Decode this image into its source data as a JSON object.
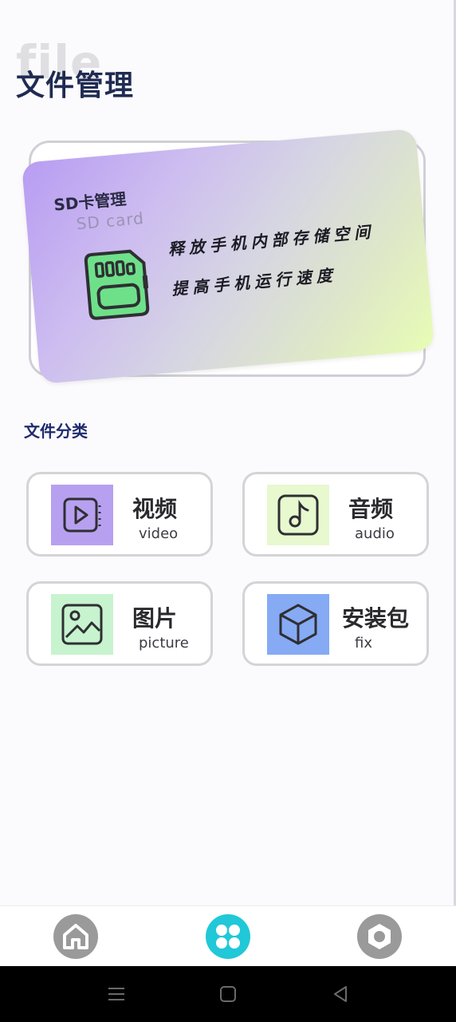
{
  "header": {
    "watermark": "file",
    "title": "文件管理"
  },
  "banner": {
    "title": "SD卡管理",
    "subtitle": "SD card",
    "line1": "释放手机内部存储空间",
    "line2": "提高手机运行速度",
    "icon": "sd-card-icon",
    "colors": {
      "gradient_start": "#b89cf2",
      "gradient_end": "#e8fdb4",
      "sd_icon": "#6ee08a"
    }
  },
  "categories": {
    "title": "文件分类",
    "items": [
      {
        "label": "视频",
        "sub": "video",
        "icon": "video-icon",
        "color": "#b7a0f0"
      },
      {
        "label": "音频",
        "sub": "audio",
        "icon": "music-note-icon",
        "color": "#e8f8cf"
      },
      {
        "label": "图片",
        "sub": "picture",
        "icon": "image-icon",
        "color": "#c7f3cf"
      },
      {
        "label": "安装包",
        "sub": "fix",
        "icon": "package-box-icon",
        "color": "#86aaf4"
      }
    ]
  },
  "nav": {
    "items": [
      {
        "icon": "home-icon",
        "active": false
      },
      {
        "icon": "apps-grid-icon",
        "active": true
      },
      {
        "icon": "settings-icon",
        "active": false
      }
    ],
    "colors": {
      "active": "#20c8d8",
      "inactive": "#9a9a9a"
    }
  },
  "system_bar": {
    "buttons": [
      "menu-icon",
      "square-home-icon",
      "back-triangle-icon"
    ]
  }
}
